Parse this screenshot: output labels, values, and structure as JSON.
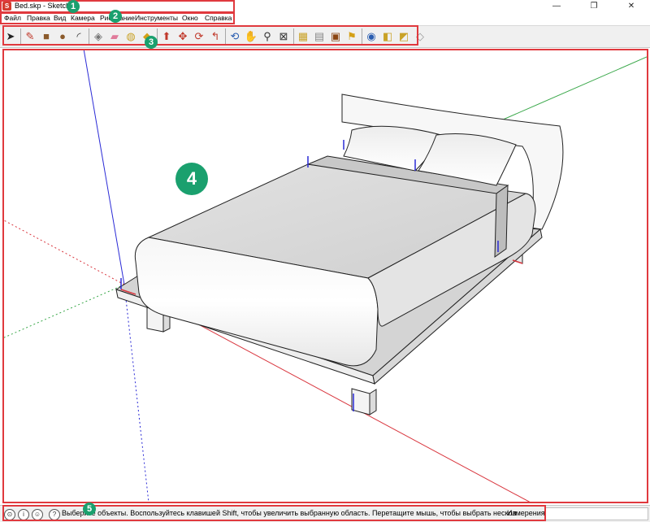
{
  "window": {
    "title": "Bed.skp - SketchUp",
    "minimize": "—",
    "maximize": "❐",
    "close": "✕"
  },
  "menu": {
    "items": [
      "Файл",
      "Правка",
      "Вид",
      "Камера",
      "Рисование",
      "Инструменты",
      "Окно",
      "Справка"
    ]
  },
  "toolbar": {
    "tools": [
      {
        "name": "select-tool",
        "icon": "select-arrow-icon",
        "glyph": "➤",
        "color": "#222222"
      },
      {
        "name": "pencil-tool",
        "icon": "pencil-icon",
        "glyph": "✎",
        "color": "#c0392b"
      },
      {
        "name": "rectangle-tool",
        "icon": "rectangle-icon",
        "glyph": "■",
        "color": "#8b5a2b"
      },
      {
        "name": "circle-tool",
        "icon": "circle-icon",
        "glyph": "●",
        "color": "#8b5a2b"
      },
      {
        "name": "arc-tool",
        "icon": "arc-icon",
        "glyph": "◜",
        "color": "#333333"
      },
      {
        "name": "make-component-tool",
        "icon": "component-icon",
        "glyph": "◈",
        "color": "#777777"
      },
      {
        "name": "eraser-tool",
        "icon": "eraser-icon",
        "glyph": "▰",
        "color": "#e07a9a"
      },
      {
        "name": "tape-measure-tool",
        "icon": "tape-measure-icon",
        "glyph": "◍",
        "color": "#c9a227"
      },
      {
        "name": "paint-bucket-tool",
        "icon": "paint-bucket-icon",
        "glyph": "◆",
        "color": "#d4a017"
      },
      {
        "name": "push-pull-tool",
        "icon": "push-pull-icon",
        "glyph": "⬆",
        "color": "#c0392b"
      },
      {
        "name": "move-tool",
        "icon": "move-icon",
        "glyph": "✥",
        "color": "#c0392b"
      },
      {
        "name": "rotate-tool",
        "icon": "rotate-icon",
        "glyph": "⟳",
        "color": "#c0392b"
      },
      {
        "name": "follow-me-tool",
        "icon": "follow-me-icon",
        "glyph": "↰",
        "color": "#c0392b"
      },
      {
        "name": "orbit-tool",
        "icon": "orbit-icon",
        "glyph": "⟲",
        "color": "#2a5db0"
      },
      {
        "name": "pan-tool",
        "icon": "hand-icon",
        "glyph": "✋",
        "color": "#444444"
      },
      {
        "name": "zoom-tool",
        "icon": "magnifier-icon",
        "glyph": "⚲",
        "color": "#333333"
      },
      {
        "name": "zoom-extents-tool",
        "icon": "zoom-extents-icon",
        "glyph": "⊠",
        "color": "#333333"
      },
      {
        "name": "3d-warehouse-tool",
        "icon": "warehouse-icon",
        "glyph": "▦",
        "color": "#c9a227"
      },
      {
        "name": "share-model-tool",
        "icon": "share-model-icon",
        "glyph": "▤",
        "color": "#888888"
      },
      {
        "name": "get-models-tool",
        "icon": "models-icon",
        "glyph": "▣",
        "color": "#8b4513"
      },
      {
        "name": "extension-warehouse-tool",
        "icon": "extension-icon",
        "glyph": "⚑",
        "color": "#d4a017"
      },
      {
        "name": "layout-tool",
        "icon": "layout-icon",
        "glyph": "◉",
        "color": "#2a5db0"
      },
      {
        "name": "section-plane-tool",
        "icon": "section-plane-icon",
        "glyph": "◧",
        "color": "#c9a227"
      },
      {
        "name": "styles-tool",
        "icon": "styles-icon",
        "glyph": "◩",
        "color": "#c9a227"
      },
      {
        "name": "scenes-tool",
        "icon": "scenes-icon",
        "glyph": "◇",
        "color": "#999999"
      }
    ]
  },
  "status": {
    "icons": [
      {
        "name": "geo-location-icon",
        "glyph": "⊙"
      },
      {
        "name": "credits-icon",
        "glyph": "i"
      },
      {
        "name": "user-icon",
        "glyph": "☺"
      }
    ],
    "help_glyph": "?",
    "message": "Выберите объекты. Воспользуйтесь клавишей Shift, чтобы увеличить выбранную область. Перетащите мышь, чтобы выбрать нескол",
    "measurements_label": "Измерения",
    "measurements_value": ""
  },
  "annotations": [
    {
      "name": "callout-1-titlebar",
      "number": "1"
    },
    {
      "name": "callout-2-menubar",
      "number": "2"
    },
    {
      "name": "callout-3-toolbar",
      "number": "3"
    },
    {
      "name": "callout-4-viewport",
      "number": "4"
    },
    {
      "name": "callout-5-statusbar",
      "number": "5"
    }
  ],
  "colors": {
    "callout_border": "#e0393e",
    "callout_badge": "#1aa06e",
    "axis_red": "#d9363e",
    "axis_green": "#3aa84a",
    "axis_blue": "#2b2bd6"
  }
}
